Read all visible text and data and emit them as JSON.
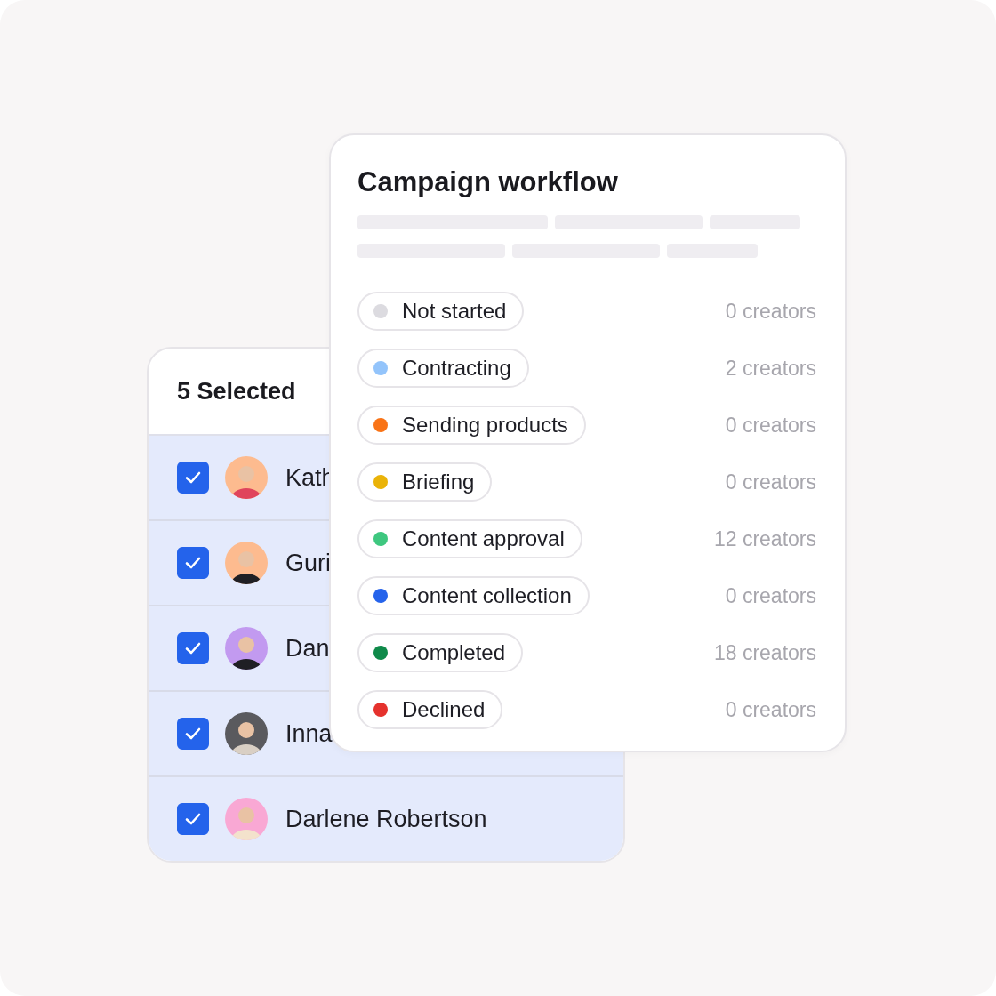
{
  "selection_panel": {
    "title": "5 Selected",
    "rows": [
      {
        "name": "Kath",
        "checked": true
      },
      {
        "name": "Guri",
        "checked": true
      },
      {
        "name": "Dan",
        "checked": true
      },
      {
        "name": "Inna",
        "checked": true
      },
      {
        "name": "Darlene Robertson",
        "checked": true
      }
    ]
  },
  "workflow_panel": {
    "title": "Campaign workflow",
    "stages": [
      {
        "label": "Not started",
        "color": "#dcdbe0",
        "count": "0 creators"
      },
      {
        "label": "Contracting",
        "color": "#93c4fb",
        "count": "2 creators"
      },
      {
        "label": "Sending products",
        "color": "#f97316",
        "count": "0 creators"
      },
      {
        "label": "Briefing",
        "color": "#eab308",
        "count": "0 creators"
      },
      {
        "label": "Content approval",
        "color": "#3ec77f",
        "count": "12 creators"
      },
      {
        "label": "Content collection",
        "color": "#2563eb",
        "count": "0 creators"
      },
      {
        "label": "Completed",
        "color": "#0f8a4a",
        "count": "18 creators"
      },
      {
        "label": "Declined",
        "color": "#e5322d",
        "count": "0 creators"
      }
    ]
  }
}
